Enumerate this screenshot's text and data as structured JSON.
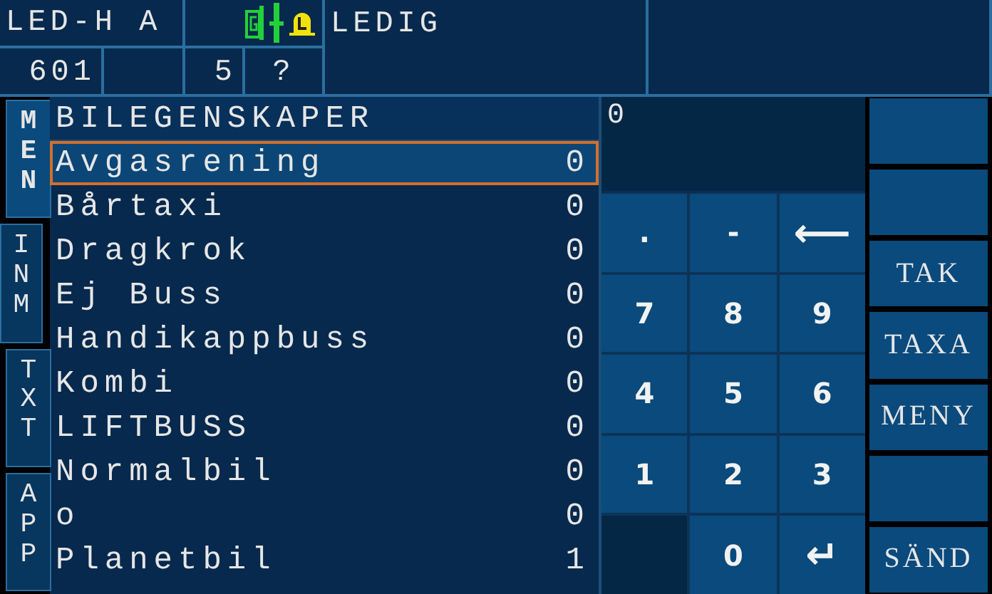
{
  "header": {
    "unit": "LED-H A",
    "status": "LEDIG",
    "car_number": "601",
    "count": "5",
    "query": "?"
  },
  "side_tabs": [
    {
      "label": "MEN",
      "selected": true
    },
    {
      "label": "INM",
      "selected": false
    },
    {
      "label": "TXT",
      "selected": false
    },
    {
      "label": "APP",
      "selected": false
    }
  ],
  "list": {
    "title": "BILEGENSKAPER",
    "items": [
      {
        "name": "Avgasrening",
        "value": "0",
        "selected": true
      },
      {
        "name": "Bårtaxi",
        "value": "0",
        "selected": false
      },
      {
        "name": "Dragkrok",
        "value": "0",
        "selected": false
      },
      {
        "name": "Ej Buss",
        "value": "0",
        "selected": false
      },
      {
        "name": "Handikappbuss",
        "value": "0",
        "selected": false
      },
      {
        "name": "Kombi",
        "value": "0",
        "selected": false
      },
      {
        "name": "LIFTBUSS",
        "value": "0",
        "selected": false
      },
      {
        "name": "Normalbil",
        "value": "0",
        "selected": false
      },
      {
        "name": "o",
        "value": "0",
        "selected": false
      },
      {
        "name": "Planetbil",
        "value": "1",
        "selected": false
      }
    ]
  },
  "display": {
    "value": "0"
  },
  "keypad": [
    {
      "kind": "key",
      "label": "."
    },
    {
      "kind": "key",
      "label": "-"
    },
    {
      "kind": "key",
      "label": "⟵"
    },
    {
      "kind": "key",
      "label": "7"
    },
    {
      "kind": "key",
      "label": "8"
    },
    {
      "kind": "key",
      "label": "9"
    },
    {
      "kind": "key",
      "label": "4"
    },
    {
      "kind": "key",
      "label": "5"
    },
    {
      "kind": "key",
      "label": "6"
    },
    {
      "kind": "key",
      "label": "1"
    },
    {
      "kind": "key",
      "label": "2"
    },
    {
      "kind": "key",
      "label": "3"
    },
    {
      "kind": "blank"
    },
    {
      "kind": "key",
      "label": "0"
    },
    {
      "kind": "key",
      "label": "↵"
    }
  ],
  "function_buttons": [
    {
      "kind": "blank"
    },
    {
      "kind": "blank"
    },
    {
      "kind": "labeled",
      "label": "TAK"
    },
    {
      "kind": "labeled",
      "label": "TAXA"
    },
    {
      "kind": "labeled",
      "label": "MENY"
    },
    {
      "kind": "blank"
    },
    {
      "kind": "labeled",
      "label": "SÄND"
    }
  ]
}
